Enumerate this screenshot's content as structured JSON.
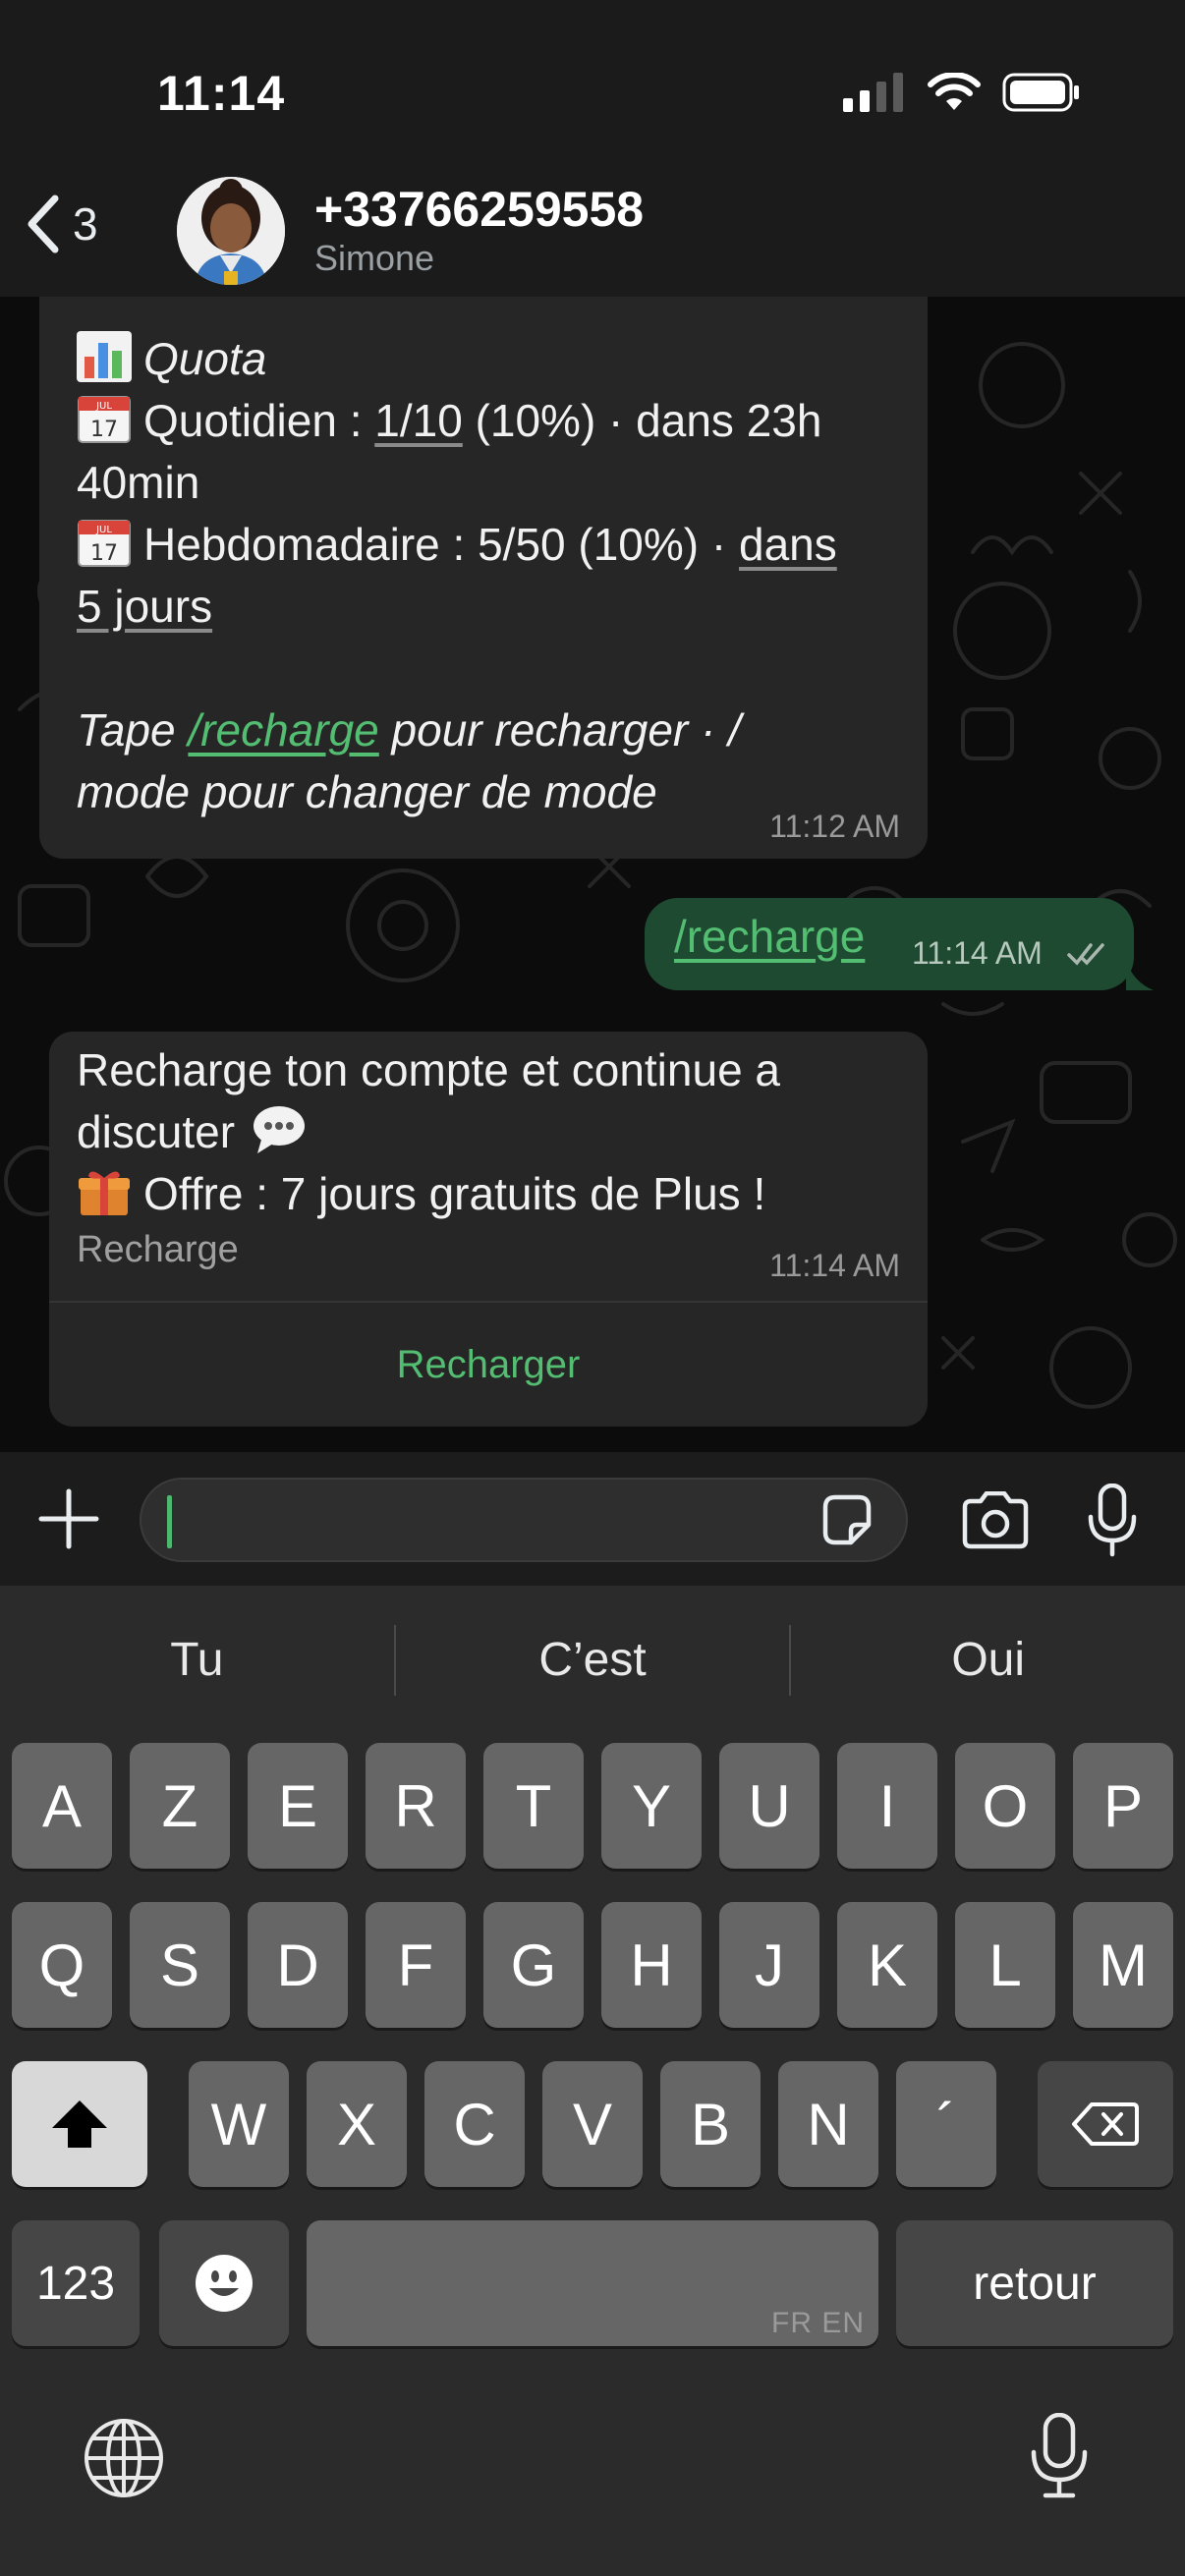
{
  "status_bar": {
    "time": "11:14"
  },
  "header": {
    "back_count": "3",
    "contact_number": "+33766259558",
    "contact_name": "Simone"
  },
  "messages": {
    "quota": {
      "title": "Quota",
      "daily_label": "Quotidien : ",
      "daily_value": "1/10",
      "daily_rest": " (10%) · dans 23h",
      "daily_rest2": "40min",
      "weekly_label": "Hebdomadaire : 5/50 (10%) · ",
      "weekly_link1": "dans",
      "weekly_link2": "5 jours",
      "tip_prefix": "Tape ",
      "tip_link": "/recharge",
      "tip_mid": " pour recharger · /",
      "tip_end": "mode pour changer de mode",
      "time": "11:12 AM",
      "calendar_month": "JUL",
      "calendar_day": "17"
    },
    "outgoing": {
      "text": "/recharge",
      "time": "11:14 AM"
    },
    "recharge": {
      "line1": "Recharge ton compte et continue a",
      "line2": "discuter ",
      "line3": "Offre : 7 jours gratuits de Plus !",
      "footer": "Recharge",
      "time": "11:14 AM",
      "button": "Recharger"
    }
  },
  "keyboard": {
    "suggestions": [
      "Tu",
      "C’est",
      "Oui"
    ],
    "row1": [
      "A",
      "Z",
      "E",
      "R",
      "T",
      "Y",
      "U",
      "I",
      "O",
      "P"
    ],
    "row2": [
      "Q",
      "S",
      "D",
      "F",
      "G",
      "H",
      "J",
      "K",
      "L",
      "M"
    ],
    "row3": [
      "W",
      "X",
      "C",
      "V",
      "B",
      "N",
      "´"
    ],
    "numbers_label": "123",
    "return_label": "retour",
    "space_languages": "FR EN"
  },
  "colors": {
    "accent_green": "#53bd72",
    "outgoing_bubble": "#1f4a32",
    "incoming_bubble": "#262626"
  },
  "icons": [
    "back-chevron-icon",
    "signal-icon",
    "wifi-icon",
    "battery-icon",
    "plus-icon",
    "sticker-icon",
    "camera-icon",
    "microphone-icon",
    "shift-icon",
    "backspace-icon",
    "emoji-icon",
    "globe-icon",
    "dictation-icon",
    "read-receipt-icon"
  ]
}
